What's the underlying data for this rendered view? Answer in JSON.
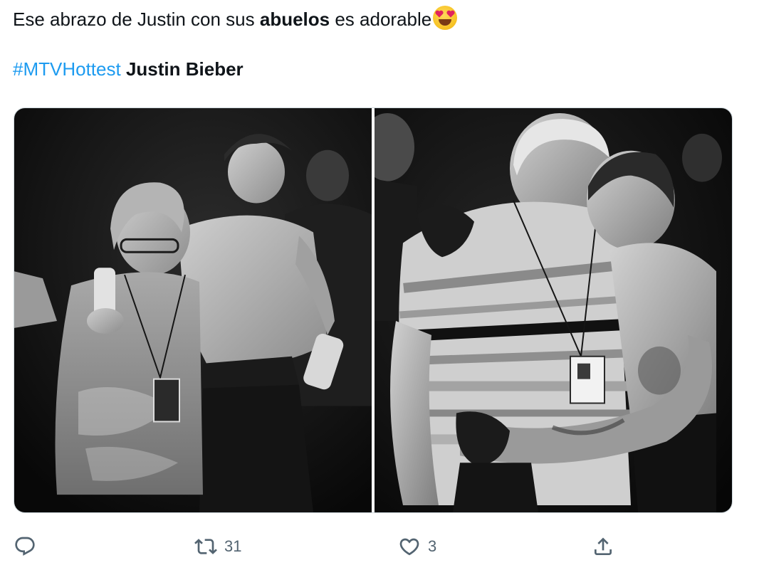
{
  "tweet": {
    "text_part1": "Ese abrazo de Justin con sus ",
    "text_bold": "abuelos",
    "text_part2": " es adorable",
    "emoji": "heart-eyes-emoji",
    "hashtag": "#MTVHottest",
    "mention_name": "Justin Bieber"
  },
  "media": {
    "photos": [
      {
        "icon": "photo-woman-hugging-justin"
      },
      {
        "icon": "photo-man-hugging-justin"
      }
    ],
    "tone": "black-and-white"
  },
  "actions": {
    "reply": {
      "icon": "reply-icon",
      "count": ""
    },
    "retweet": {
      "icon": "retweet-icon",
      "count": "31"
    },
    "like": {
      "icon": "heart-icon",
      "count": "3"
    },
    "share": {
      "icon": "share-icon",
      "count": ""
    }
  },
  "colors": {
    "hashtag": "#1d9bf0",
    "text": "#0f1419",
    "muted": "#536471",
    "border": "#cfd9de"
  }
}
